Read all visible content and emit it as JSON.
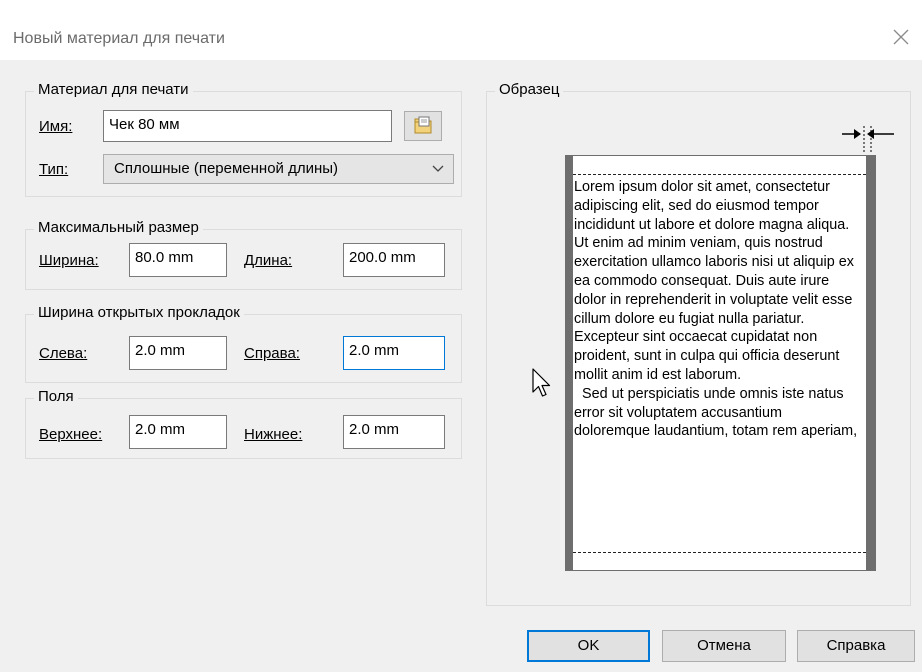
{
  "window": {
    "title": "Новый материал для печати"
  },
  "material": {
    "legend": "Материал для печати",
    "name_label": "Имя:",
    "name_value": "Чек 80 мм",
    "type_label": "Тип:",
    "type_value": "Сплошные (переменной длины)"
  },
  "max_size": {
    "legend": "Максимальный размер",
    "width_label": "Ширина:",
    "width_value": "80.0 mm",
    "length_label": "Длина:",
    "length_value": "200.0 mm"
  },
  "pads": {
    "legend": "Ширина открытых прокладок",
    "left_label": "Слева:",
    "left_value": "2.0 mm",
    "right_label": "Справа:",
    "right_value": "2.0 mm"
  },
  "margins": {
    "legend": "Поля",
    "top_label": "Верхнее:",
    "top_value": "2.0 mm",
    "bottom_label": "Нижнее:",
    "bottom_value": "2.0 mm"
  },
  "sample": {
    "legend": "Образец",
    "paragraph1": "Lorem ipsum dolor sit amet, consectetur adipiscing elit, sed do eiusmod tempor incididunt ut labore et dolore magna aliqua. Ut enim ad minim veniam, quis nostrud exercitation ullamco laboris nisi ut aliquip ex ea commodo consequat. Duis aute irure dolor in reprehenderit in voluptate velit esse cillum dolore eu fugiat nulla pariatur. Excepteur sint occaecat cupidatat non proident, sunt in culpa qui officia deserunt mollit anim id est laborum.",
    "paragraph2": "Sed ut perspiciatis unde omnis iste natus error sit voluptatem accusantium doloremque laudantium, totam rem aperiam,"
  },
  "buttons": {
    "ok": "OK",
    "cancel": "Отмена",
    "help": "Справка"
  },
  "icons": {
    "close": "close-icon",
    "browse": "folder-browse-icon",
    "cursor": "mouse-pointer-icon",
    "pad_marker": "pad-width-arrows-icon"
  },
  "colors": {
    "focus_border": "#0078d7",
    "paper_edge": "#6e6e6e"
  }
}
